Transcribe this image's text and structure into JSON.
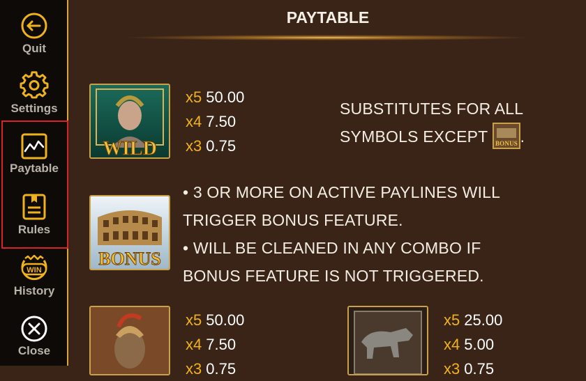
{
  "sidebar": {
    "items": [
      {
        "label": "Quit",
        "icon": "quit-icon"
      },
      {
        "label": "Settings",
        "icon": "gear-icon"
      },
      {
        "label": "Paytable",
        "icon": "paytable-icon"
      },
      {
        "label": "Rules",
        "icon": "rules-icon"
      },
      {
        "label": "History",
        "icon": "history-win-icon",
        "badge": "WIN"
      },
      {
        "label": "Close",
        "icon": "close-icon"
      }
    ]
  },
  "main": {
    "title": "PAYTABLE",
    "symbols": [
      {
        "name": "WILD",
        "pays": [
          {
            "mult": "x5",
            "value": "50.00"
          },
          {
            "mult": "x4",
            "value": "7.50"
          },
          {
            "mult": "x3",
            "value": "0.75"
          }
        ],
        "description": [
          "SUBSTITUTES FOR ALL",
          "SYMBOLS EXCEPT",
          "."
        ]
      },
      {
        "name": "BONUS",
        "description": [
          "• 3 OR MORE ON ACTIVE PAYLINES WILL",
          "TRIGGER BONUS FEATURE.",
          "• WILL BE CLEANED IN ANY COMBO IF",
          "BONUS FEATURE IS NOT TRIGGERED."
        ]
      },
      {
        "name": "Gladiator",
        "pays": [
          {
            "mult": "x5",
            "value": "50.00"
          },
          {
            "mult": "x4",
            "value": "7.50"
          },
          {
            "mult": "x3",
            "value": "0.75"
          }
        ]
      },
      {
        "name": "Wolf",
        "pays": [
          {
            "mult": "x5",
            "value": "25.00"
          },
          {
            "mult": "x4",
            "value": "5.00"
          },
          {
            "mult": "x3",
            "value": "0.75"
          }
        ]
      }
    ]
  },
  "colors": {
    "background": "#3a2418",
    "sidebar": "#0d0a08",
    "accent_gold": "#f0b21c",
    "highlight": "#d9232a"
  }
}
